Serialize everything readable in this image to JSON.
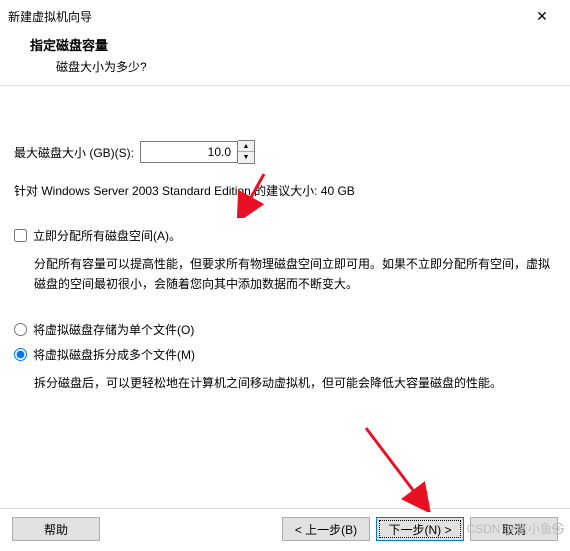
{
  "window": {
    "title": "新建虚拟机向导",
    "close_symbol": "✕"
  },
  "header": {
    "title": "指定磁盘容量",
    "subtitle": "磁盘大小为多少?"
  },
  "disk": {
    "label": "最大磁盘大小 (GB)(S):",
    "value": "10.0",
    "recommendation": "针对 Windows Server 2003 Standard Edition 的建议大小: 40 GB"
  },
  "allocate": {
    "checkbox_label": "立即分配所有磁盘空间(A)。",
    "checked": false,
    "description": "分配所有容量可以提高性能，但要求所有物理磁盘空间立即可用。如果不立即分配所有空间，虚拟磁盘的空间最初很小，会随着您向其中添加数据而不断变大。"
  },
  "split": {
    "options": [
      {
        "label": "将虚拟磁盘存储为单个文件(O)",
        "value": "single",
        "selected": false
      },
      {
        "label": "将虚拟磁盘拆分成多个文件(M)",
        "value": "multi",
        "selected": true
      }
    ],
    "description": "拆分磁盘后，可以更轻松地在计算机之间移动虚拟机，但可能会降低大容量磁盘的性能。"
  },
  "footer": {
    "help": "帮助",
    "back": "< 上一步(B)",
    "next": "下一步(N) >",
    "cancel": "取消"
  },
  "watermark": "CSDN @张小鱼㉿"
}
